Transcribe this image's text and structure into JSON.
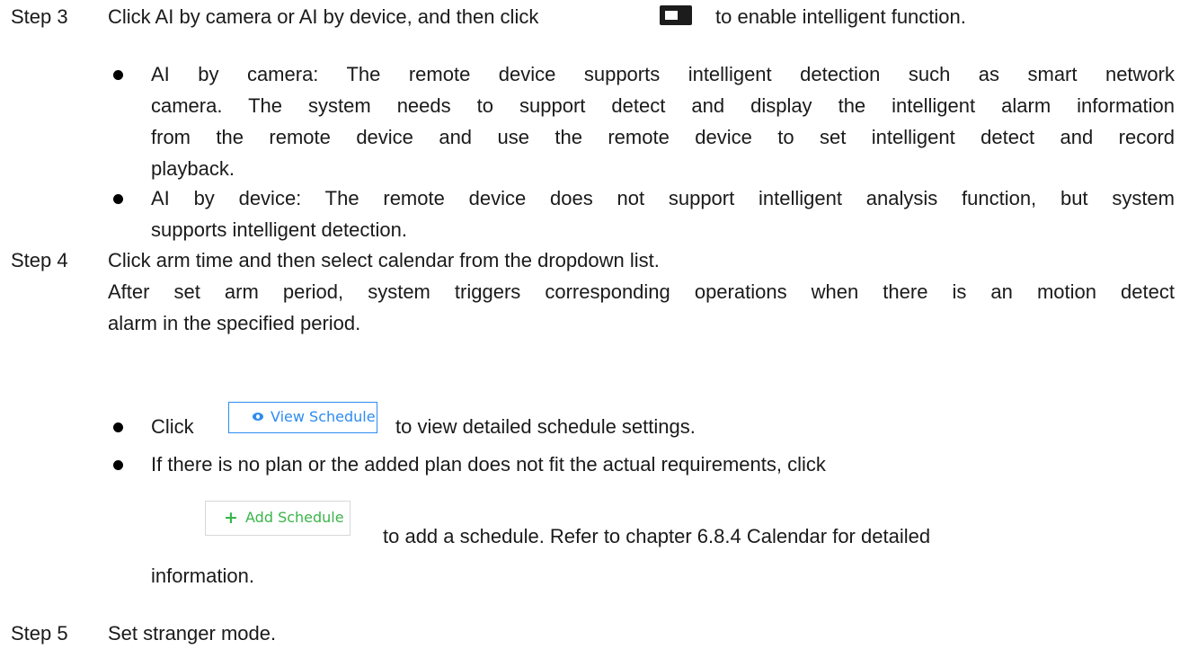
{
  "step3": {
    "label": "Step 3",
    "text_before": "Click AI by camera or AI by device, and then click",
    "text_after": "to enable intelligent function.",
    "bullet1": {
      "l1": "AI by camera: The remote device supports intelligent detection such as smart network",
      "l2": "camera. The system needs to support detect and display the intelligent alarm information",
      "l3": "from the remote device and use the remote device to set intelligent detect and record",
      "l4": "playback."
    },
    "bullet2": {
      "l1": "AI by device: The remote device does not support intelligent analysis function, but system",
      "l2": "supports intelligent detection."
    }
  },
  "step4": {
    "label": "Step 4",
    "text": "Click arm time and then select calendar from the dropdown list.",
    "desc_l1": "After set arm period, system triggers corresponding operations when there is an motion detect",
    "desc_l2": "alarm in the specified period.",
    "bullet1": {
      "click": "Click",
      "button_label": "View Schedule",
      "after": "to view detailed schedule settings."
    },
    "bullet2": {
      "l1": "If there is no plan or the added plan does not fit the actual requirements, click",
      "button_label": "Add Schedule",
      "after": "to add a schedule. Refer to chapter 6.8.4 Calendar for detailed",
      "l3": "information."
    }
  },
  "step5": {
    "label": "Step 5",
    "text": "Set stranger mode."
  },
  "icons": {
    "toggle": "toggle-switch-icon",
    "view": "eye-icon",
    "add": "plus-icon"
  },
  "colors": {
    "view_button": "#2d8cf0",
    "add_button": "#3bb54a",
    "toggle": "#1c1c1c"
  }
}
